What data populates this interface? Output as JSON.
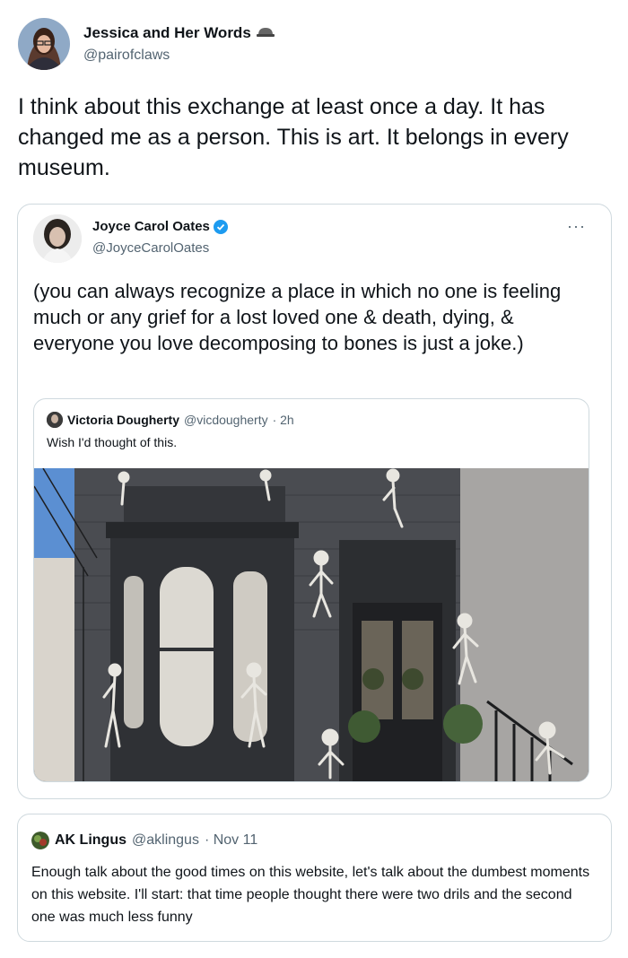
{
  "main_tweet": {
    "author_name": "Jessica and Her Words",
    "author_handle": "@pairofclaws",
    "text": "I think about this exchange at least once a day. It has changed me as a person. This is art. It belongs in every museum."
  },
  "quoted_tweet": {
    "author_name": "Joyce Carol Oates",
    "author_handle": "@JoyceCarolOates",
    "more_label": "···",
    "text": "(you can always recognize a place in which no one is feeling much or any grief for a lost loved one & death, dying, & everyone you love decomposing to bones is just a joke.)"
  },
  "nested_quote": {
    "author_name": "Victoria Dougherty",
    "author_handle": "@vicdougherty",
    "time": "· 2h",
    "text": "Wish I'd thought of this.",
    "photo_icon": "house-with-skeletons-photo"
  },
  "reply_card": {
    "author_name": "AK Lingus",
    "author_handle": "@aklingus",
    "time": "· Nov 11",
    "text": "Enough talk about the good times on this website, let's talk about the dumbest moments on this website. I'll start: that time people thought there were two drils and the second one was much less funny"
  },
  "colors": {
    "text_primary": "#0f1419",
    "text_secondary": "#536471",
    "border": "#cfd9de",
    "verified_blue": "#1d9bf0"
  }
}
